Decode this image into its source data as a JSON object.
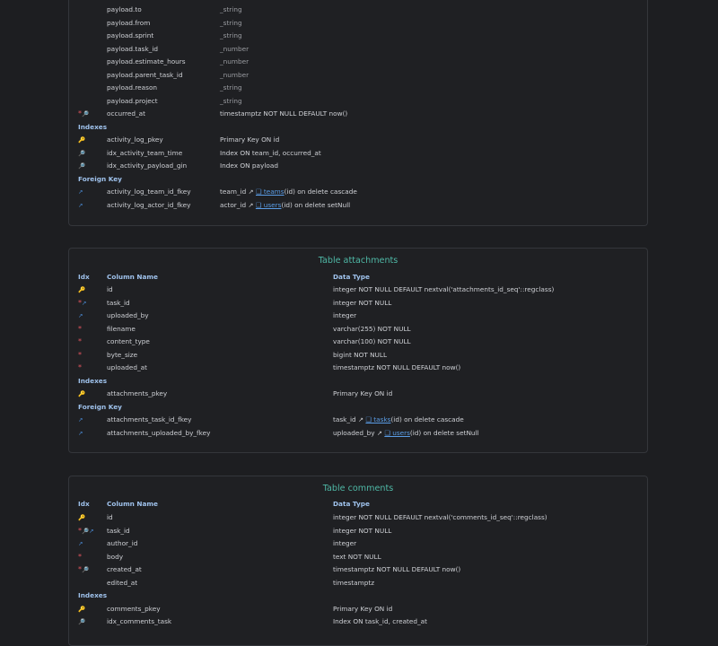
{
  "activity": {
    "payload_rows": [
      {
        "name": "payload.to",
        "type": "_string"
      },
      {
        "name": "payload.from",
        "type": "_string"
      },
      {
        "name": "payload.sprint",
        "type": "_string"
      },
      {
        "name": "payload.task_id",
        "type": "_number"
      },
      {
        "name": "payload.estimate_hours",
        "type": "_number"
      },
      {
        "name": "payload.parent_task_id",
        "type": "_number"
      },
      {
        "name": "payload.reason",
        "type": "_string"
      },
      {
        "name": "payload.project",
        "type": "_string"
      }
    ],
    "occurred_at": {
      "icon": "*🔎",
      "name": "occurred_at",
      "type": "timestamptz NOT NULL DEFAULT now()"
    },
    "indexes_label": "Indexes",
    "indexes": [
      {
        "icon": "🔑",
        "name": "activity_log_pkey",
        "def": "Primary Key ON id"
      },
      {
        "icon": "🔎",
        "name": "idx_activity_team_time",
        "def": "Index ON team_id, occurred_at"
      },
      {
        "icon": "🔎",
        "name": "idx_activity_payload_gin",
        "def": "Index ON payload"
      }
    ],
    "fk_label": "Foreign Key",
    "fks": [
      {
        "icon": "↗",
        "name": "activity_log_team_id_fkey",
        "col": "team_id ↗",
        "ref": "❏ teams",
        "rest": "(id) on delete cascade"
      },
      {
        "icon": "↗",
        "name": "activity_log_actor_id_fkey",
        "col": "actor_id ↗",
        "ref": "❏ users",
        "rest": "(id) on delete setNull"
      }
    ]
  },
  "attachments": {
    "title": "Table attachments",
    "headers": {
      "idx": "Idx",
      "name": "Column Name",
      "type": "Data Type"
    },
    "columns": [
      {
        "icon": "🔑",
        "name": "id",
        "type": "integer NOT NULL DEFAULT nextval('attachments_id_seq'::regclass)"
      },
      {
        "icon": "*↗",
        "name": "task_id",
        "type": "integer NOT NULL"
      },
      {
        "icon": "↗",
        "name": "uploaded_by",
        "type": "integer"
      },
      {
        "icon": "*",
        "name": "filename",
        "type": "varchar(255) NOT NULL"
      },
      {
        "icon": "*",
        "name": "content_type",
        "type": "varchar(100) NOT NULL"
      },
      {
        "icon": "*",
        "name": "byte_size",
        "type": "bigint NOT NULL"
      },
      {
        "icon": "*",
        "name": "uploaded_at",
        "type": "timestamptz NOT NULL DEFAULT now()"
      }
    ],
    "indexes_label": "Indexes",
    "indexes": [
      {
        "icon": "🔑",
        "name": "attachments_pkey",
        "def": "Primary Key ON id"
      }
    ],
    "fk_label": "Foreign Key",
    "fks": [
      {
        "icon": "↗",
        "name": "attachments_task_id_fkey",
        "col": "task_id ↗",
        "ref": "❏ tasks",
        "rest": "(id) on delete cascade"
      },
      {
        "icon": "↗",
        "name": "attachments_uploaded_by_fkey",
        "col": "uploaded_by ↗",
        "ref": "❏ users",
        "rest": "(id) on delete setNull"
      }
    ]
  },
  "comments": {
    "title": "Table comments",
    "headers": {
      "idx": "Idx",
      "name": "Column Name",
      "type": "Data Type"
    },
    "columns": [
      {
        "icon": "🔑",
        "name": "id",
        "type": "integer NOT NULL DEFAULT nextval('comments_id_seq'::regclass)"
      },
      {
        "icon": "*🔎↗",
        "name": "task_id",
        "type": "integer NOT NULL"
      },
      {
        "icon": "↗",
        "name": "author_id",
        "type": "integer"
      },
      {
        "icon": "*",
        "name": "body",
        "type": "text NOT NULL"
      },
      {
        "icon": "*🔎",
        "name": "created_at",
        "type": "timestamptz NOT NULL DEFAULT now()"
      },
      {
        "icon": "",
        "name": "edited_at",
        "type": "timestamptz"
      }
    ],
    "indexes_label": "Indexes",
    "indexes": [
      {
        "icon": "🔑",
        "name": "comments_pkey",
        "def": "Primary Key ON id"
      },
      {
        "icon": "🔎",
        "name": "idx_comments_task",
        "def": "Index ON task_id, created_at"
      }
    ]
  }
}
